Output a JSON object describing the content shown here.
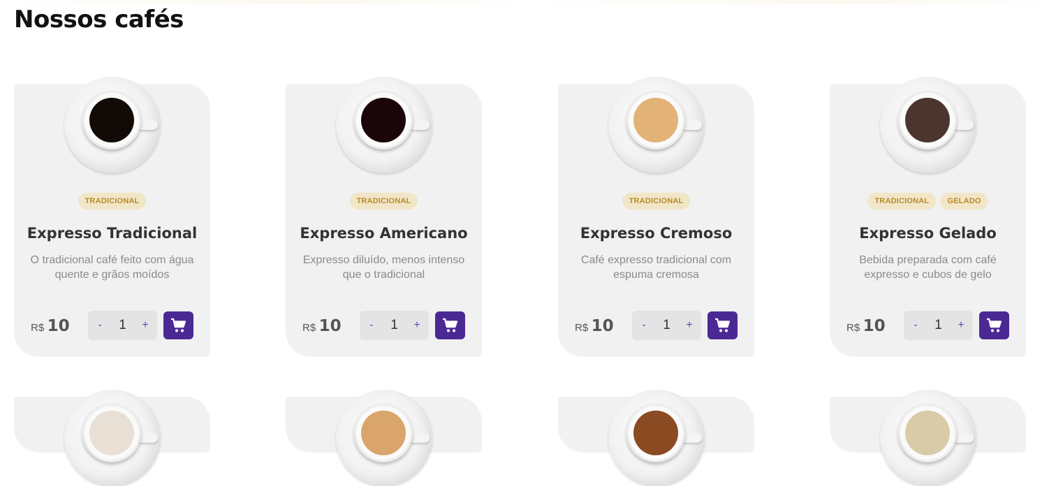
{
  "page": {
    "title": "Nossos cafés"
  },
  "products": [
    {
      "name": "Expresso Tradicional",
      "description": "O tradicional café feito com água quente e grãos moídos",
      "tags": [
        "TRADICIONAL"
      ],
      "currency": "R$",
      "price": "10",
      "quantity": "1",
      "coffee_color": "#120a06",
      "coffee_rim": "#7a4a1c"
    },
    {
      "name": "Expresso Americano",
      "description": "Expresso diluído, menos intenso que o tradicional",
      "tags": [
        "TRADICIONAL"
      ],
      "currency": "R$",
      "price": "10",
      "quantity": "1",
      "coffee_color": "#1a0508",
      "coffee_rim": "#3a1a14"
    },
    {
      "name": "Expresso Cremoso",
      "description": "Café expresso tradicional com espuma cremosa",
      "tags": [
        "TRADICIONAL"
      ],
      "currency": "R$",
      "price": "10",
      "quantity": "1",
      "coffee_color": "#e2b276",
      "coffee_rim": "#c9914e"
    },
    {
      "name": "Expresso Gelado",
      "description": "Bebida preparada com café expresso e cubos de gelo",
      "tags": [
        "TRADICIONAL",
        "GELADO"
      ],
      "currency": "R$",
      "price": "10",
      "quantity": "1",
      "coffee_color": "#4a362e",
      "coffee_rim": "#7a4a1c"
    }
  ],
  "row2_cups": [
    {
      "coffee_color": "#e8e0d4"
    },
    {
      "coffee_color": "#d9a56a"
    },
    {
      "coffee_color": "#8a4a22"
    },
    {
      "coffee_color": "#d9cba8"
    }
  ],
  "controls": {
    "minus": "-",
    "plus": "+"
  },
  "icons": {
    "cart": "cart-icon"
  },
  "colors": {
    "accent": "#4b2995",
    "tag_bg": "#f1e6c7",
    "tag_text": "#b98b2a"
  }
}
